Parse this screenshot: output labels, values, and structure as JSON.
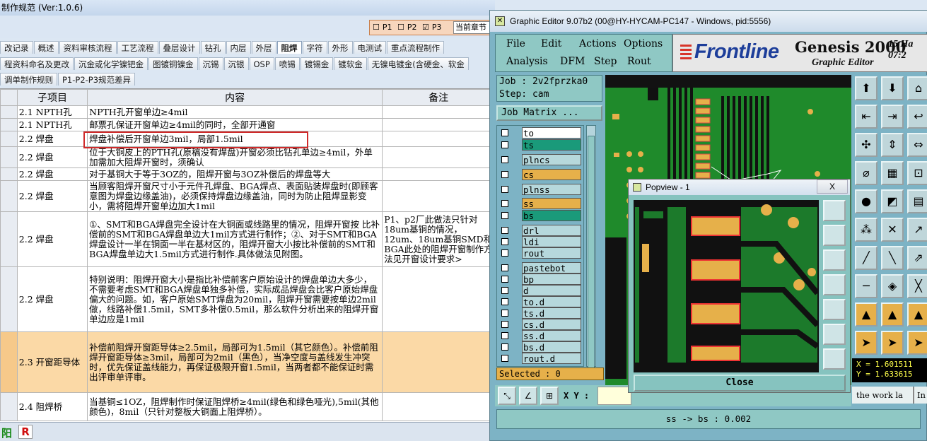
{
  "spreadsheet": {
    "title": "制作规范 (Ver:1.0.6)",
    "check_panel": {
      "p1": "P1",
      "p2": "P2",
      "p3": "P3",
      "current_chapter": "当前章节"
    },
    "tabs_row1": [
      "改记录",
      "概述",
      "资料审核流程",
      "工艺流程",
      "叠层设计",
      "钻孔",
      "内层",
      "外层",
      "阻焊",
      "字符",
      "外形",
      "电测试",
      "重点流程制作"
    ],
    "active_tab": "阻焊",
    "tabs_row2": [
      "程资料命名及更改",
      "沉金或化学镍钯金",
      "图镀铜镍金",
      "沉锡",
      "沉银",
      "OSP",
      "喷锡",
      "镀锡金",
      "镀软金",
      "无镍电镀金(含硬金、软金"
    ],
    "tabs_row3": [
      "调单制作规则",
      "P1-P2-P3规范差异"
    ],
    "headers": [
      "子项目",
      "内容",
      "备注"
    ],
    "rows": [
      {
        "sub": "2.1 NPTH孔",
        "content": "NPTH孔开窗单边≥4mil",
        "note": ""
      },
      {
        "sub": "2.1 NPTH孔",
        "content": "邮票孔保证开窗单边≥4mil的同时，全部开通窗",
        "note": ""
      },
      {
        "sub": "2.2 焊盘",
        "content": "焊盘补偿后开窗单边3mil，局部1.5mil",
        "note": ""
      },
      {
        "sub": "2.2 焊盘",
        "content": "位于大铜皮上的PTH孔(原稿没有焊盘)开窗必须比钻孔单边≥4mil，外单加需加大阻焊开窗时，须确认",
        "note": ""
      },
      {
        "sub": "2.2 焊盘",
        "content": "对于基铜大于等于3OZ的，阻焊开窗与3OZ补偿后的焊盘等大",
        "note": ""
      },
      {
        "sub": "2.2 焊盘",
        "content": "当顾客阻焊开窗尺寸小于元件孔焊盘、BGA焊点、表面贴装焊盘时(即顾客意图为焊盘边缘盖油)，必须保持焊盘边缘盖油，同时为防止阻焊显影变小，需将阻焊开窗单边加大1mil",
        "note": ""
      },
      {
        "sub": "2.2 焊盘",
        "content": "①、SMT和BGA焊盘完全设计在大铜面或线路里的情况，阻焊开窗按 比补偿前的SMT和BGA焊盘单边大1mil方式进行制作；②、对于SMT和BGA焊盘设计一半在铜面一半在基材区的，阻焊开窗大小按比补偿前的SMT和BGA焊盘单边大1.5mil方式进行制作.具体做法见附图。",
        "note": "P1、p2厂此做法只针对18um基铜的情况，12um、18um基铜SMD和BGA此处的阻焊开窗制作方法见开窗设计要求>"
      },
      {
        "sub": "2.2 焊盘",
        "content": "特别说明：阻焊开窗大小是指比补偿前客户原始设计的焊盘单边大多少，不需要考虑SMT和BGA焊盘单独多补偿，实际成品焊盘会比客户原始焊盘偏大的问题。如，客户原始SMT焊盘为20mil，阻焊开窗需要按单边2mil做，线路补偿1.5mil，SMT多补偿0.5mil，那么软件分析出来的阻焊开窗单边应是1mil",
        "note": ""
      },
      {
        "sub": "2.3 开窗距导体",
        "content": "补偿前阻焊开窗距导体≥2.5mil，局部可为1.5mil（其它颜色）。补偿前阻焊开窗距导体≥3mil，局部可为2mil（黑色），当净空度与盖线发生冲突时，优先保证盖线能力，再保证极限开窗1.5mil，当两者都不能保证时需出评审单评审。",
        "note": ""
      },
      {
        "sub": "2.4 阻焊桥",
        "content": "当基铜≤1OZ，阻焊制作时保证阻焊桥≥4mil(绿色和绿色哑光),5mil(其他颜色)，8mil（只针对整板大铜面上阻焊桥）。",
        "note": ""
      }
    ],
    "status_icons": [
      "阳",
      "R"
    ]
  },
  "editor": {
    "title": "Graphic Editor 9.07b2 (00@HY-HYCAM-PC147 - Windows, pid:5556)",
    "menu": [
      "File",
      "Edit",
      "Actions",
      "Options",
      "Analysis",
      "DFM",
      "Step",
      "Rout"
    ],
    "brand": "Frontline",
    "product": "Genesis 2000",
    "product_sub": "Graphic Editor",
    "date_line1": "15 Ha",
    "date_line2": "07:2",
    "job_label": "Job : 2v2fprzka0",
    "step_label": "Step: cam",
    "job_matrix": "Job Matrix ...",
    "layers": [
      {
        "name": "to",
        "color": "#ffffff",
        "row_color": "#7db3c5"
      },
      {
        "name": "ts",
        "color": "#1a9a7a",
        "row_color": "#7db3c5"
      },
      {
        "name": "plncs",
        "color": "#b6d8dc",
        "row_color": "#7db3c5"
      },
      {
        "name": "cs",
        "color": "#e6b04a",
        "row_color": "#7db3c5"
      },
      {
        "name": "plnss",
        "color": "#b6d8dc",
        "row_color": "#7db3c5"
      },
      {
        "name": "ss",
        "color": "#e6b04a",
        "row_color": "#7db3c5"
      },
      {
        "name": "bs",
        "color": "#1a9a7a",
        "row_color": "#7db3c5"
      },
      {
        "name": "drl",
        "color": "#b6d8dc",
        "row_color": "#7db3c5"
      },
      {
        "name": "ldi",
        "color": "#b6d8dc",
        "row_color": "#7db3c5"
      },
      {
        "name": "rout",
        "color": "#b6d8dc",
        "row_color": "#7db3c5"
      },
      {
        "name": "pastebot",
        "color": "#b6d8dc",
        "row_color": "#7db3c5"
      },
      {
        "name": "bp",
        "color": "#b6d8dc",
        "row_color": "#7db3c5"
      },
      {
        "name": "d",
        "color": "#b6d8dc",
        "row_color": "#7db3c5"
      },
      {
        "name": "to.d",
        "color": "#b6d8dc",
        "row_color": "#7db3c5"
      },
      {
        "name": "ts.d",
        "color": "#b6d8dc",
        "row_color": "#7db3c5"
      },
      {
        "name": "cs.d",
        "color": "#b6d8dc",
        "row_color": "#7db3c5"
      },
      {
        "name": "ss.d",
        "color": "#b6d8dc",
        "row_color": "#7db3c5"
      },
      {
        "name": "bs.d",
        "color": "#b6d8dc",
        "row_color": "#7db3c5"
      },
      {
        "name": "rout.d",
        "color": "#b6d8dc",
        "row_color": "#7db3c5"
      }
    ],
    "selected": "Selected : 0",
    "xy_label": "X Y :",
    "coords_x": "X = 1.601511",
    "coords_y": "Y = 1.633615",
    "hint": "the work la",
    "hint_btn": "In",
    "status": "ss -> bs : 0.002"
  },
  "popview": {
    "title": "Popview - 1",
    "close_x": "X",
    "close_label": "Close"
  }
}
